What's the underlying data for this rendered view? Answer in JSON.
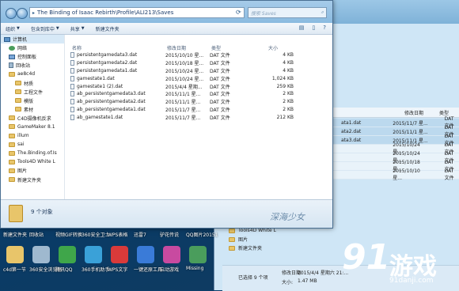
{
  "address_path": "The Binding of Isaac Rebirth\\Profile\\ALI213\\Saves",
  "search_placeholder": "搜索 Saves",
  "toolbar": {
    "organize": "组织",
    "include_in_library": "包含到库中",
    "share": "共享",
    "new_folder": "新建文件夹"
  },
  "nav_items": [
    {
      "label": "计算机",
      "icon": "computer-icon",
      "selected": true
    },
    {
      "label": "网络",
      "icon": "network-icon"
    },
    {
      "label": "控制面板",
      "icon": "control-panel-icon"
    },
    {
      "label": "回收站",
      "icon": "recycle-bin-icon"
    },
    {
      "label": "ae8c4d",
      "icon": "folder-icon"
    },
    {
      "label": "材质",
      "icon": "folder-icon"
    },
    {
      "label": "工程文件",
      "icon": "folder-icon"
    },
    {
      "label": "模版",
      "icon": "folder-icon"
    },
    {
      "label": "素材",
      "icon": "folder-icon"
    },
    {
      "label": "C4D摄像机反求",
      "icon": "folder-icon"
    },
    {
      "label": "GameMaker 8.1",
      "icon": "folder-icon"
    },
    {
      "label": "illum",
      "icon": "folder-icon"
    },
    {
      "label": "sai",
      "icon": "folder-icon"
    },
    {
      "label": "The.Binding.of.Is",
      "icon": "folder-icon"
    },
    {
      "label": "Tools4D White L",
      "icon": "folder-icon"
    },
    {
      "label": "图片",
      "icon": "folder-icon"
    },
    {
      "label": "新建文件夹",
      "icon": "folder-icon"
    }
  ],
  "columns": {
    "name": "名称",
    "date": "修改日期",
    "type": "类型",
    "size": "大小"
  },
  "files": [
    {
      "name": "persistentgamedata3.dat",
      "date": "2015/10/10 星...",
      "type": "DAT 文件",
      "size": "4 KB"
    },
    {
      "name": "persistentgamedata2.dat",
      "date": "2015/10/18 星...",
      "type": "DAT 文件",
      "size": "4 KB"
    },
    {
      "name": "persistentgamedata1.dat",
      "date": "2015/10/24 星...",
      "type": "DAT 文件",
      "size": "4 KB"
    },
    {
      "name": "gamestate1.dat",
      "date": "2015/10/24 星...",
      "type": "DAT 文件",
      "size": "1,024 KB"
    },
    {
      "name": "gamestate1 (2).dat",
      "date": "2015/4/4 星期...",
      "type": "DAT 文件",
      "size": "259 KB"
    },
    {
      "name": "ab_persistentgamedata3.dat",
      "date": "2015/11/1 星...",
      "type": "DAT 文件",
      "size": "2 KB"
    },
    {
      "name": "ab_persistentgamedata2.dat",
      "date": "2015/11/1 星...",
      "type": "DAT 文件",
      "size": "2 KB"
    },
    {
      "name": "ab_persistentgamedata1.dat",
      "date": "2015/11/7 星...",
      "type": "DAT 文件",
      "size": "2 KB"
    },
    {
      "name": "ab_gamestate1.dat",
      "date": "2015/11/7 星...",
      "type": "DAT 文件",
      "size": "212 KB"
    }
  ],
  "item_count": "9 个对象",
  "watermark": "深海少女",
  "back_window": {
    "columns": {
      "date": "修改日期",
      "type": "类型"
    },
    "rows": [
      {
        "name": "ata1.dat",
        "date": "2015/11/7 星...",
        "type": "DAT 文件"
      },
      {
        "name": "ata2.dat",
        "date": "2015/11/1 星...",
        "type": "DAT 文件"
      },
      {
        "name": "ata3.dat",
        "date": "2015/11/1 星...",
        "type": "DAT 文件"
      },
      {
        "name": "",
        "date": "2015/10/24 星...",
        "type": "DAT 文件"
      },
      {
        "name": "",
        "date": "2015/10/24 星...",
        "type": "DAT 文件"
      },
      {
        "name": "",
        "date": "2015/10/18 星...",
        "type": "DAT 文件"
      },
      {
        "name": "",
        "date": "2015/10/10 星...",
        "type": "DAT 文件"
      }
    ],
    "side_items": [
      "The.Binding.of.Is",
      "Tools4D White L",
      "图片",
      "新建文件夹"
    ],
    "status_selected": "已选择 9 个项",
    "status_date_label": "修改日期:",
    "status_date_value": "2015/4/4 星期六 21:...",
    "status_size_label": "大小:",
    "status_size_value": "1.47 MB"
  },
  "desktop_labels_row1": [
    "新建文件夹",
    "回收站",
    "视频GIF转换",
    "360安全卫士",
    "WPS表格",
    "迅雷7",
    "驴花传说",
    "QQ图片20151"
  ],
  "desktop_labels_row2": [
    "c4d第一节",
    "360安全浏览器",
    "腾讯QQ",
    "360手机助手",
    "WPS文字",
    "一键还原工具",
    "启动游戏",
    "Missing"
  ],
  "desktop_labels_row3": [
    "",
    "",
    "",
    "",
    "",
    "",
    "",
    ""
  ],
  "logo_text": "游戏",
  "logo_number": "91",
  "logo_url": "91danji.com"
}
